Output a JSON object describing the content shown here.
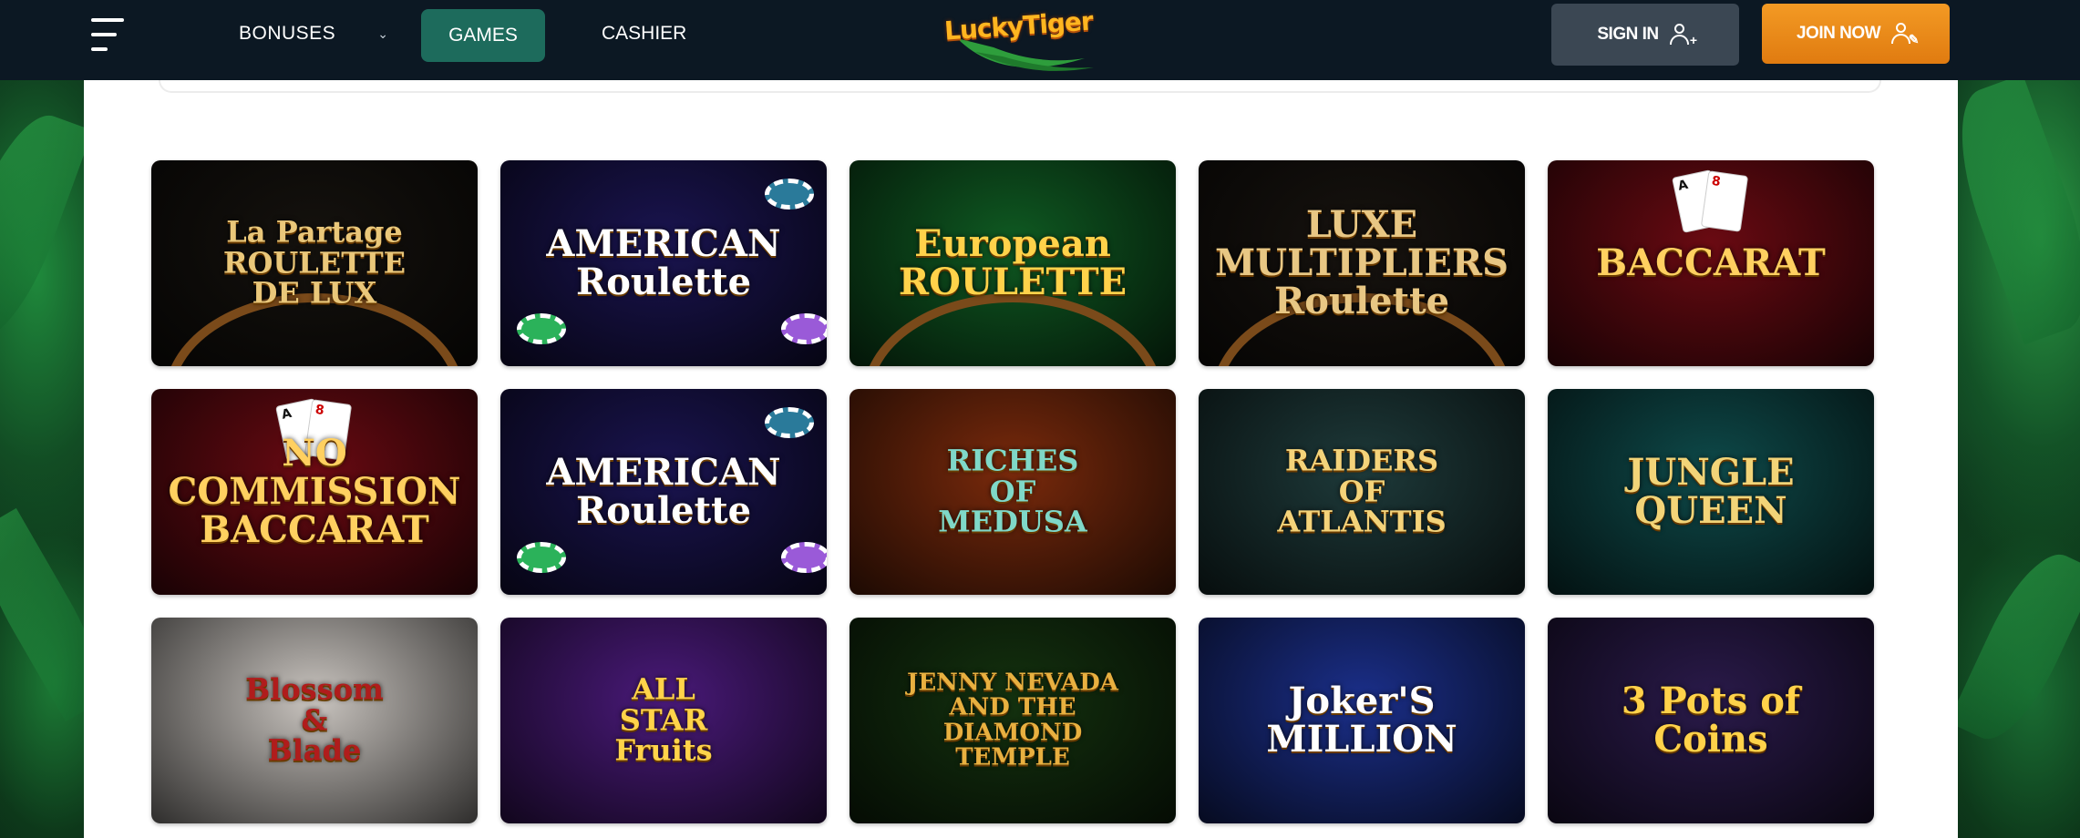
{
  "header": {
    "menu_icon": "hamburger-menu-icon",
    "nav": {
      "bonuses": "BONUSES",
      "games": "GAMES",
      "cashier": "CASHIER"
    },
    "logo_text": "LuckyTiger",
    "sign_in": "SIGN IN",
    "join_now": "JOIN NOW"
  },
  "games": [
    {
      "name": "La Partage Roulette de Lux",
      "title": "La Partage\nROULETTE\nDE LUX",
      "bg": "#15120e",
      "color": "#e9c77a",
      "art": "wheel"
    },
    {
      "name": "American Roulette",
      "title": "AMERICAN\nRoulette",
      "bg": "#1a1450",
      "color": "#ffffff",
      "art": "chips"
    },
    {
      "name": "European Roulette",
      "title": "European\nROULETTE",
      "bg": "#0f5a22",
      "color": "#ffd24a",
      "art": "wheel"
    },
    {
      "name": "Luxe Multipliers Roulette",
      "title": "LUXE MULTIPLIERS\nRoulette",
      "bg": "#17130f",
      "color": "#e8c784",
      "art": "wheel"
    },
    {
      "name": "Baccarat",
      "title": "BACCARAT",
      "bg": "#6a0a12",
      "color": "#ffd060",
      "art": "cards"
    },
    {
      "name": "No Commission Baccarat",
      "title": "NO COMMISSION\nBACCARAT",
      "bg": "#6a0a12",
      "color": "#ffd060",
      "art": "cards"
    },
    {
      "name": "American Roulette",
      "title": "AMERICAN\nRoulette",
      "bg": "#1a1450",
      "color": "#ffffff",
      "art": "chips"
    },
    {
      "name": "Riches of Medusa",
      "title": "RICHES\nOF\nMEDUSA",
      "bg": "#7a2a0c",
      "color": "#7fd8c8",
      "art": "none"
    },
    {
      "name": "Raiders of Atlantis",
      "title": "RAIDERS\nOF\nATLANTIS",
      "bg": "#1e3a3a",
      "color": "#f4d37a",
      "art": "none"
    },
    {
      "name": "Jungle Queen",
      "title": "JUNGLE\nQUEEN",
      "bg": "#0e4a4a",
      "color": "#f2d478",
      "art": "none"
    },
    {
      "name": "Blossom & Blade",
      "title": "Blossom\n&\nBlade",
      "bg": "#c9c4bf",
      "color": "#b01c1c",
      "art": "none"
    },
    {
      "name": "All Star Fruits",
      "title": "ALL\nSTAR\nFruits",
      "bg": "#4a1a7a",
      "color": "#ffd34a",
      "art": "none"
    },
    {
      "name": "Jenny Nevada and the Diamond Temple",
      "title": "JENNY NEVADA\nAND THE\nDIAMOND\nTEMPLE",
      "bg": "#14320f",
      "color": "#e8b040",
      "art": "none"
    },
    {
      "name": "Joker's Million",
      "title": "Joker'S\nMILLION",
      "bg": "#1b2f8a",
      "color": "#ffffff",
      "art": "none"
    },
    {
      "name": "3 Pots of Coins",
      "title": "3 Pots of\nCoins",
      "bg": "#2a1a4a",
      "color": "#ffd24a",
      "art": "none"
    }
  ],
  "colors": {
    "header_bg": "#0c1823",
    "games_tab_bg": "#1d6b5c",
    "sign_in_bg": "#3b4753",
    "join_now_bg": "#f08f1c",
    "panel_bg": "#ffffff"
  }
}
